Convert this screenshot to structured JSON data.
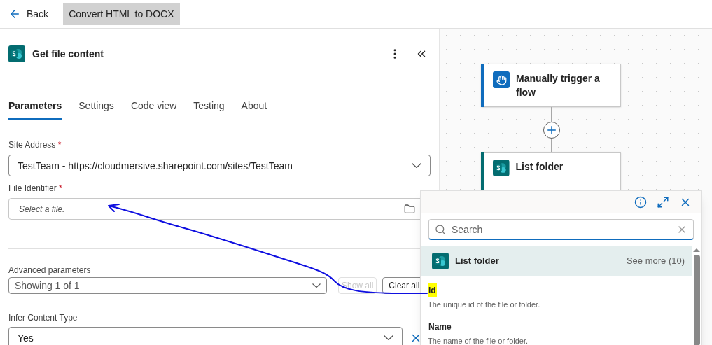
{
  "top_bar": {
    "back_label": "Back",
    "flow_title": "Convert HTML to DOCX"
  },
  "panel": {
    "title": "Get file content",
    "tabs": [
      {
        "label": "Parameters",
        "selected": true
      },
      {
        "label": "Settings",
        "selected": false
      },
      {
        "label": "Code view",
        "selected": false
      },
      {
        "label": "Testing",
        "selected": false
      },
      {
        "label": "About",
        "selected": false
      }
    ],
    "site_address": {
      "label": "Site Address",
      "required_mark": "*",
      "value": "TestTeam - https://cloudmersive.sharepoint.com/sites/TestTeam"
    },
    "file_identifier": {
      "label": "File Identifier",
      "required_mark": "*",
      "placeholder": "Select a file."
    },
    "advanced": {
      "label": "Advanced parameters",
      "value": "Showing 1 of 1",
      "show_all": {
        "label": "Show all",
        "disabled": true
      },
      "clear_all": {
        "label": "Clear all"
      }
    },
    "infer_content_type": {
      "label": "Infer Content Type",
      "value": "Yes"
    }
  },
  "canvas": {
    "nodes": [
      {
        "title": "Manually trigger a flow",
        "kind": "trigger",
        "color": "#0f6cbd"
      },
      {
        "title": "List folder",
        "kind": "sharepoint",
        "color": "#036c70"
      }
    ]
  },
  "dynamic_content": {
    "search_placeholder": "Search",
    "group": {
      "title": "List folder",
      "see_more": "See more (10)"
    },
    "items": [
      {
        "name": "Id",
        "description": "The unique id of the file or folder.",
        "highlighted": true
      },
      {
        "name": "Name",
        "description": "The name of the file or folder.",
        "highlighted": false
      }
    ]
  }
}
